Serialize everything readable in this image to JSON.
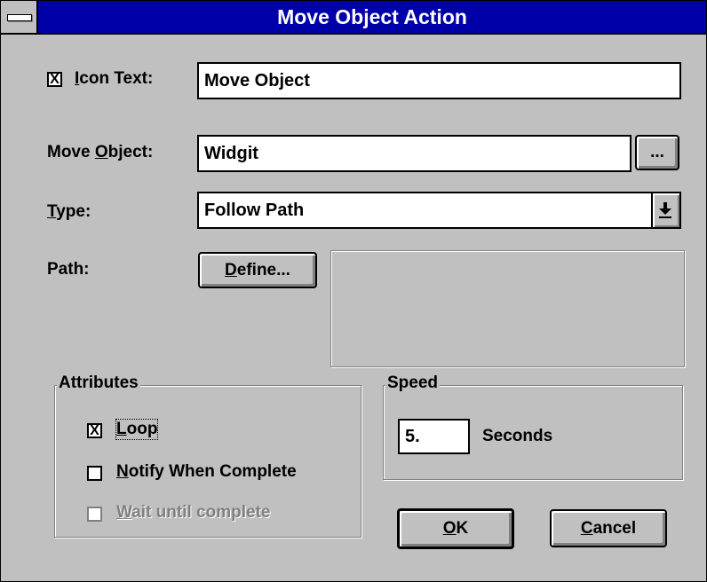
{
  "window": {
    "title": "Move Object Action"
  },
  "icon_text": {
    "checked": true,
    "check_mark": "X",
    "label_access": "I",
    "label_rest": "con Text:",
    "value": "Move Object"
  },
  "move_object": {
    "label_pre": "Move ",
    "label_access": "O",
    "label_rest": "bject:",
    "value": "Widgit",
    "browse_label": "..."
  },
  "type": {
    "label_access": "T",
    "label_rest": "ype:",
    "value": "Follow Path"
  },
  "path": {
    "label": "Path:",
    "define_access": "D",
    "define_rest": "efine..."
  },
  "attributes": {
    "title": "Attributes",
    "loop": {
      "label_access": "L",
      "label_rest": "oop",
      "checked": true,
      "check_mark": "X"
    },
    "notify": {
      "label_access": "N",
      "label_rest": "otify When Complete",
      "checked": false
    },
    "wait": {
      "label_access": "W",
      "label_rest": "ait until complete",
      "checked": false,
      "disabled": true
    }
  },
  "speed": {
    "title": "Speed",
    "value": "5.",
    "unit": "Seconds"
  },
  "buttons": {
    "ok_access": "O",
    "ok_rest": "K",
    "cancel_access": "C",
    "cancel_rest": "ancel"
  }
}
